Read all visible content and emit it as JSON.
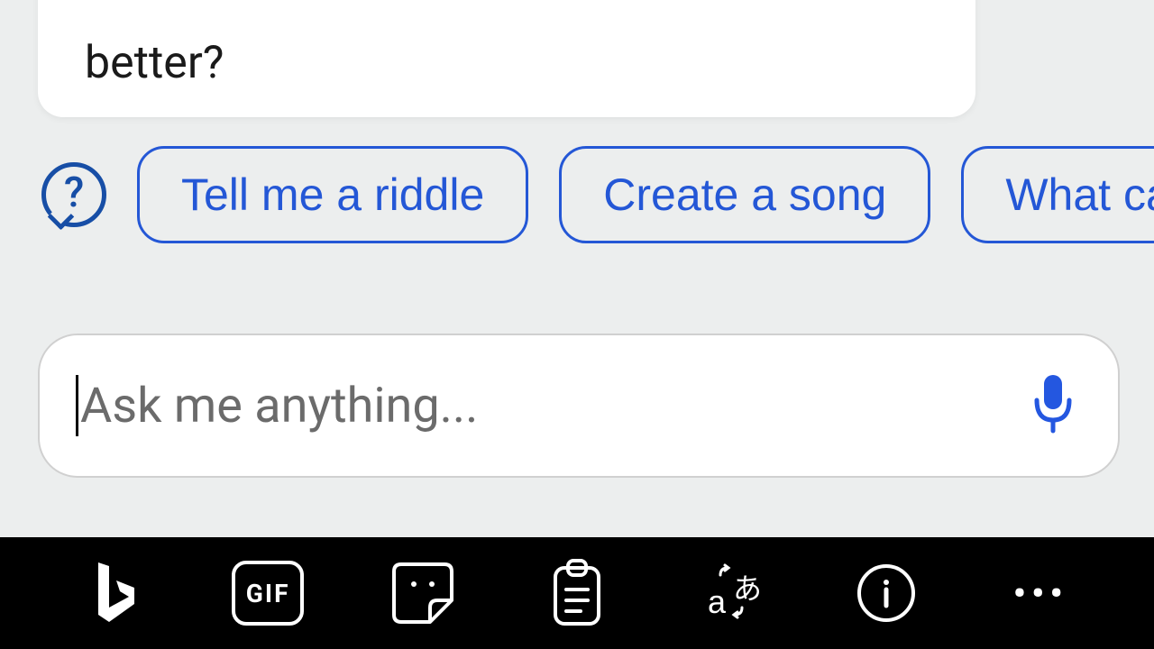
{
  "message": {
    "fragment": "better?"
  },
  "suggestions": {
    "items": [
      {
        "label": "Tell me a riddle"
      },
      {
        "label": "Create a song"
      },
      {
        "label": "What can yo"
      }
    ]
  },
  "input": {
    "placeholder": "Ask me anything..."
  },
  "toolbar": {
    "gif_label": "GIF"
  }
}
